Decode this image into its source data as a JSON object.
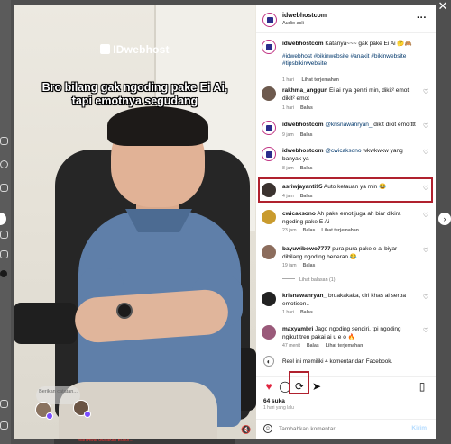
{
  "backdrop": {
    "close_icon": "close-icon",
    "bottom_text": "Man Awal Gunakan Editor..."
  },
  "video": {
    "brand": "IDwebhost",
    "caption_line1": "Bro bilang gak ngoding pake Ei Ai,",
    "caption_line2": "tapi emotnya segudang",
    "bubble_text": "Berikan catatan..."
  },
  "post": {
    "username": "idwebhostcom",
    "audio": "Audio asli",
    "caption_user": "idwebhostcom",
    "caption_text": "Katanya~~~ gak pake Ei Ai 🤔🙈",
    "hashtags": "#idwebhost #bikinwebsite #anakit #bikinwebsite #tipsbikinwebsite",
    "caption_time": "1 hari",
    "caption_translate": "Lihat terjemahan"
  },
  "comments": [
    {
      "user": "rakhma_anggun",
      "text": "Ei ai nya genzi min, dikit² emot dikit² emot",
      "time": "1 hari",
      "reply": "Balas",
      "extra": ""
    },
    {
      "user": "idwebhostcom",
      "mention": "@krisnawanryan_",
      "text": "dikit dikit emotttt",
      "time": "9 jam",
      "reply": "Balas",
      "extra": ""
    },
    {
      "user": "idwebhostcom",
      "mention": "@cwicaksono",
      "text": "wkwkwkw yang banyak ya",
      "time": "8 jam",
      "reply": "Balas",
      "extra": ""
    },
    {
      "user": "asriwjayanti95",
      "text": "Auto ketauan ya min 😂",
      "time": "4 jam",
      "reply": "Balas",
      "extra": ""
    },
    {
      "user": "cwicaksono",
      "text": "Ah pake emot juga ah biar dikira ngoding pake E Ai",
      "time": "23 jam",
      "reply": "Balas",
      "extra": "Lihat terjemahan"
    },
    {
      "user": "bayuwibowo7777",
      "text": "pura pura pake e ai biyar dibilang ngoding beneran 😂",
      "time": "19 jam",
      "reply": "Balas",
      "extra": ""
    },
    {
      "user": "krisnawanryan_",
      "text": "bruakakaka, ciri khas ai serba emoticon..",
      "time": "1 hari",
      "reply": "Balas",
      "extra": ""
    },
    {
      "user": "maxyambri",
      "text": "Jago ngoding sendiri, tpi ngoding ngikut tren pakai ai u e o 🔥",
      "time": "47 menit",
      "reply": "Balas",
      "extra": "Lihat terjemahan"
    }
  ],
  "view_replies": "Lihat balasan (1)",
  "reel_info": "Reel ini memiliki 4 komentar dan Facebook.",
  "likes": "64 suka",
  "time_ago": "1 hari yang lalu",
  "add_comment": {
    "placeholder": "Tambahkan komentar...",
    "post_label": "Kirim"
  }
}
